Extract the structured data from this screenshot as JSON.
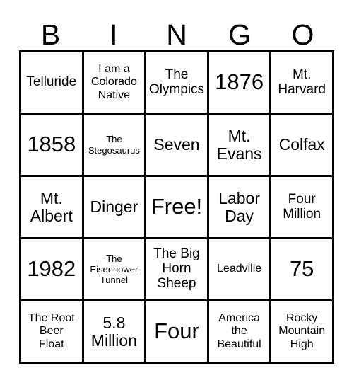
{
  "card": {
    "title_letters": [
      "B",
      "I",
      "N",
      "G",
      "O"
    ],
    "colors": {
      "background": "#ffffff",
      "border": "#000000",
      "text": "#000000"
    },
    "grid": {
      "columns": 5,
      "rows": 5,
      "free_space": "Free!"
    },
    "cells": [
      {
        "text": "Telluride",
        "size": "md"
      },
      {
        "text": "I am a\nColorado\nNative",
        "size": "sm"
      },
      {
        "text": "The\nOlympics",
        "size": "md"
      },
      {
        "text": "1876",
        "size": "xl"
      },
      {
        "text": "Mt.\nHarvard",
        "size": "md"
      },
      {
        "text": "1858",
        "size": "xl"
      },
      {
        "text": "The\nStegosaurus",
        "size": "xs"
      },
      {
        "text": "Seven",
        "size": "lg"
      },
      {
        "text": "Mt.\nEvans",
        "size": "lg"
      },
      {
        "text": "Colfax",
        "size": "lg"
      },
      {
        "text": "Mt.\nAlbert",
        "size": "lg"
      },
      {
        "text": "Dinger",
        "size": "lg"
      },
      {
        "text": "Free!",
        "size": "xl"
      },
      {
        "text": "Labor\nDay",
        "size": "lg"
      },
      {
        "text": "Four\nMillion",
        "size": "md"
      },
      {
        "text": "1982",
        "size": "xl"
      },
      {
        "text": "The\nEisenhower\nTunnel",
        "size": "xs"
      },
      {
        "text": "The Big\nHorn\nSheep",
        "size": "md"
      },
      {
        "text": "Leadville",
        "size": "sm"
      },
      {
        "text": "75",
        "size": "xl"
      },
      {
        "text": "The Root\nBeer\nFloat",
        "size": "sm"
      },
      {
        "text": "5.8\nMillion",
        "size": "lg"
      },
      {
        "text": "Four",
        "size": "xl"
      },
      {
        "text": "America\nthe\nBeautiful",
        "size": "sm"
      },
      {
        "text": "Rocky\nMountain\nHigh",
        "size": "sm"
      }
    ]
  }
}
